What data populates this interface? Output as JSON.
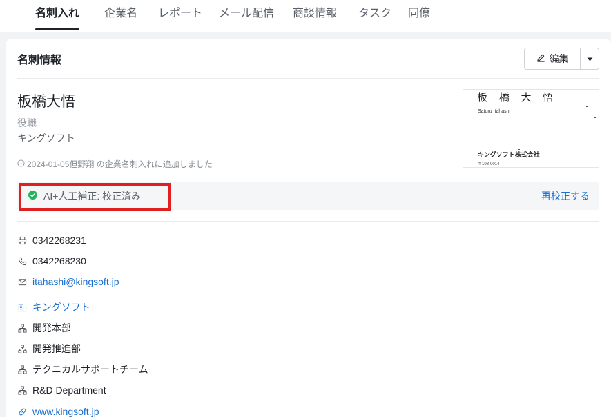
{
  "nav": {
    "tabs": [
      {
        "label": "名刺入れ",
        "active": true
      },
      {
        "label": "企業名",
        "active": false
      },
      {
        "label": "レポート",
        "active": false
      },
      {
        "label": "メール配信",
        "active": false
      },
      {
        "label": "商談情報",
        "active": false
      },
      {
        "label": "タスク",
        "active": false
      },
      {
        "label": "同僚",
        "active": false
      }
    ]
  },
  "card": {
    "title": "名刺情報",
    "edit_label": "編集",
    "edit_icon": "pencil-icon",
    "dropdown_icon": "caret-down-icon"
  },
  "person": {
    "name": "板橋大悟",
    "role": "役職",
    "company": "キングソフト",
    "added_line": "2024-01-05但野翔 の企業名刺入れに追加しました"
  },
  "business_card_image": {
    "name": "板 橋 大 悟",
    "roman": "Satoru Itahashi",
    "company": "キングソフト株式会社",
    "zip": "〒108-0014"
  },
  "status": {
    "text": "AI+人工補正: 校正済み",
    "icon": "check-circle-icon",
    "icon_color": "#22b35e",
    "recheck_label": "再校正する",
    "highlight_color": "#e02020"
  },
  "info": {
    "fax": "0342268231",
    "phone": "0342268230",
    "email": "itahashi@kingsoft.jp",
    "company_link": "キングソフト",
    "departments": [
      "開発本部",
      "開発推進部",
      "テクニカルサポートチーム",
      "R&D Department"
    ],
    "website": "www.kingsoft.jp"
  },
  "colors": {
    "link": "#1a6fd1",
    "text": "#1f2329",
    "muted": "#9aa0a6"
  }
}
